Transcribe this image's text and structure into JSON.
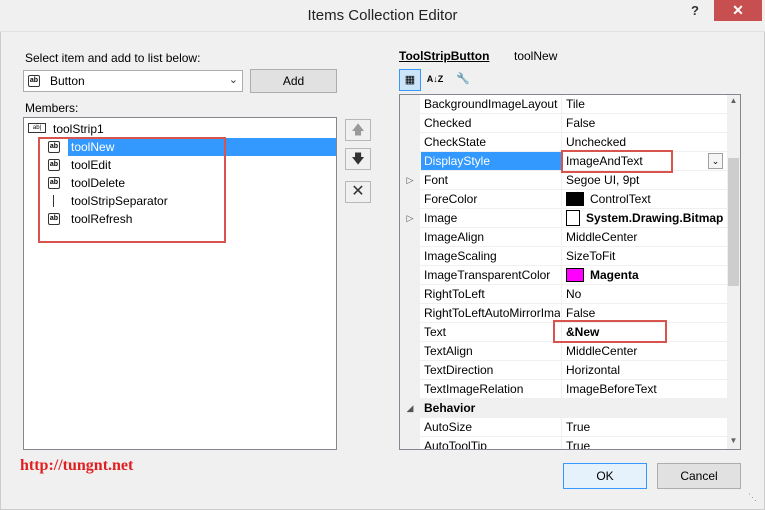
{
  "window": {
    "title": "Items Collection Editor",
    "help_label": "?",
    "close_label": "✕"
  },
  "left": {
    "select_label": "Select item and add to list below:",
    "combo_value": "Button",
    "add_label": "Add",
    "members_label": "Members:",
    "tree_root": "toolStrip1",
    "items": [
      {
        "label": "toolNew",
        "icon": "button-icon",
        "selected": true
      },
      {
        "label": "toolEdit",
        "icon": "button-icon",
        "selected": false
      },
      {
        "label": "toolDelete",
        "icon": "button-icon",
        "selected": false
      },
      {
        "label": "toolStripSeparator",
        "icon": "separator-icon",
        "selected": false
      },
      {
        "label": "toolRefresh",
        "icon": "button-icon",
        "selected": false
      }
    ]
  },
  "side_buttons": {
    "up": "move-up-icon",
    "down": "move-down-icon",
    "remove": "delete-icon"
  },
  "right": {
    "object_type": "ToolStripButton",
    "object_name": "toolNew",
    "properties": [
      {
        "name": "BackgroundImageLayout",
        "value": "Tile"
      },
      {
        "name": "Checked",
        "value": "False"
      },
      {
        "name": "CheckState",
        "value": "Unchecked"
      },
      {
        "name": "DisplayStyle",
        "value": "ImageAndText",
        "selected": true
      },
      {
        "name": "Font",
        "value": "Segoe UI, 9pt",
        "expandable": true
      },
      {
        "name": "ForeColor",
        "value": "ControlText",
        "swatch": "#000000"
      },
      {
        "name": "Image",
        "value": "System.Drawing.Bitmap",
        "expandable": true,
        "bold": true,
        "image_icon": true
      },
      {
        "name": "ImageAlign",
        "value": "MiddleCenter"
      },
      {
        "name": "ImageScaling",
        "value": "SizeToFit"
      },
      {
        "name": "ImageTransparentColor",
        "value": "Magenta",
        "swatch": "#ff00ff",
        "bold": true
      },
      {
        "name": "RightToLeft",
        "value": "No"
      },
      {
        "name": "RightToLeftAutoMirrorImage",
        "value": "False"
      },
      {
        "name": "Text",
        "value": "&New",
        "bold": true
      },
      {
        "name": "TextAlign",
        "value": "MiddleCenter"
      },
      {
        "name": "TextDirection",
        "value": "Horizontal"
      },
      {
        "name": "TextImageRelation",
        "value": "ImageBeforeText"
      },
      {
        "name": "Behavior",
        "category": true
      },
      {
        "name": "AutoSize",
        "value": "True"
      },
      {
        "name": "AutoToolTip",
        "value": "True"
      }
    ]
  },
  "footer": {
    "url": "http://tungnt.net",
    "ok_label": "OK",
    "cancel_label": "Cancel"
  },
  "colors": {
    "selection": "#3399ff",
    "highlight_box": "#d9534f",
    "url_text": "#e02020"
  }
}
